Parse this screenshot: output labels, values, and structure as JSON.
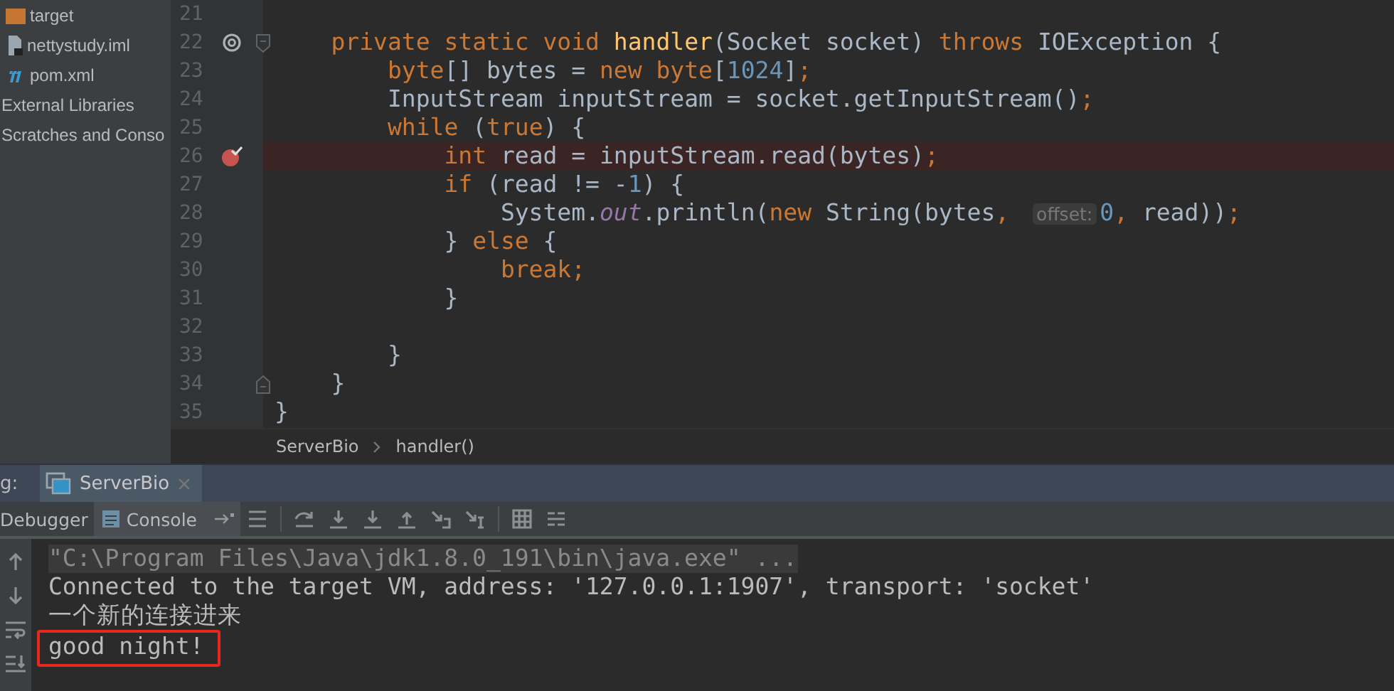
{
  "project_tree": {
    "items": [
      {
        "label": "target",
        "kind": "folder"
      },
      {
        "label": "nettystudy.iml",
        "kind": "module"
      },
      {
        "label": "pom.xml",
        "kind": "maven"
      },
      {
        "label": "External Libraries",
        "kind": "plain"
      },
      {
        "label": "Scratches and Conso",
        "kind": "plain"
      }
    ]
  },
  "editor": {
    "lines": [
      {
        "number": "21",
        "highlighted": false
      },
      {
        "number": "22",
        "override_marker": true,
        "fold_start": true,
        "highlighted": false,
        "tokens": [
          {
            "kind": "keyword",
            "text": "    private static void "
          },
          {
            "kind": "function",
            "text": "handler"
          },
          {
            "kind": "plain",
            "text": "(Socket socket) "
          },
          {
            "kind": "keyword",
            "text": "throws "
          },
          {
            "kind": "plain",
            "text": "IOException {"
          }
        ]
      },
      {
        "number": "23",
        "highlighted": false,
        "tokens": [
          {
            "kind": "keyword",
            "text": "        byte"
          },
          {
            "kind": "plain",
            "text": "[] bytes = "
          },
          {
            "kind": "keyword",
            "text": "new byte"
          },
          {
            "kind": "plain",
            "text": "["
          },
          {
            "kind": "number",
            "text": "1024"
          },
          {
            "kind": "plain",
            "text": "]"
          },
          {
            "kind": "keyword",
            "text": ";"
          }
        ]
      },
      {
        "number": "24",
        "highlighted": false,
        "tokens": [
          {
            "kind": "plain",
            "text": "        InputStream inputStream = socket.getInputStream()"
          },
          {
            "kind": "keyword",
            "text": ";"
          }
        ]
      },
      {
        "number": "25",
        "highlighted": false,
        "tokens": [
          {
            "kind": "keyword",
            "text": "        while "
          },
          {
            "kind": "plain",
            "text": "("
          },
          {
            "kind": "keyword",
            "text": "true"
          },
          {
            "kind": "plain",
            "text": ") {"
          }
        ]
      },
      {
        "number": "26",
        "breakpoint": true,
        "highlighted": true,
        "tokens": [
          {
            "kind": "keyword",
            "text": "            int "
          },
          {
            "kind": "plain",
            "text": "read = inputStream.read(bytes)"
          },
          {
            "kind": "keyword",
            "text": ";"
          }
        ]
      },
      {
        "number": "27",
        "highlighted": false,
        "tokens": [
          {
            "kind": "keyword",
            "text": "            if "
          },
          {
            "kind": "plain",
            "text": "(read != -"
          },
          {
            "kind": "number",
            "text": "1"
          },
          {
            "kind": "plain",
            "text": ") {"
          }
        ]
      },
      {
        "number": "28",
        "highlighted": false,
        "tokens": [
          {
            "kind": "plain",
            "text": "                System."
          },
          {
            "kind": "static",
            "text": "out"
          },
          {
            "kind": "plain",
            "text": ".println("
          },
          {
            "kind": "keyword",
            "text": "new "
          },
          {
            "kind": "plain",
            "text": "String(bytes"
          },
          {
            "kind": "keyword",
            "text": ", "
          },
          {
            "kind": "hint",
            "text": "offset:"
          },
          {
            "kind": "number",
            "text": "0"
          },
          {
            "kind": "keyword",
            "text": ", "
          },
          {
            "kind": "plain",
            "text": "read))"
          },
          {
            "kind": "keyword",
            "text": ";"
          }
        ]
      },
      {
        "number": "29",
        "highlighted": false,
        "tokens": [
          {
            "kind": "plain",
            "text": "            } "
          },
          {
            "kind": "keyword",
            "text": "else "
          },
          {
            "kind": "plain",
            "text": "{"
          }
        ]
      },
      {
        "number": "30",
        "highlighted": false,
        "tokens": [
          {
            "kind": "keyword",
            "text": "                break;"
          }
        ]
      },
      {
        "number": "31",
        "highlighted": false,
        "tokens": [
          {
            "kind": "plain",
            "text": "            }"
          }
        ]
      },
      {
        "number": "32",
        "highlighted": false
      },
      {
        "number": "33",
        "highlighted": false,
        "tokens": [
          {
            "kind": "plain",
            "text": "        }"
          }
        ]
      },
      {
        "number": "34",
        "fold_end": true,
        "highlighted": false,
        "tokens": [
          {
            "kind": "plain",
            "text": "    }"
          }
        ]
      },
      {
        "number": "35",
        "highlighted": false,
        "tokens": [
          {
            "kind": "plain",
            "text": "}"
          }
        ]
      }
    ],
    "breadcrumbs": [
      "ServerBio",
      "handler()"
    ]
  },
  "debug_panel": {
    "label": "g:",
    "tabs": [
      {
        "label": "ServerBio",
        "selected": true
      }
    ],
    "subtabs": [
      {
        "label": "Debugger",
        "selected": false
      },
      {
        "label": "Console",
        "selected": true
      }
    ],
    "console": [
      {
        "kind": "command",
        "text": "\"C:\\Program Files\\Java\\jdk1.8.0_191\\bin\\java.exe\" ...",
        "boxed": false
      },
      {
        "kind": "output",
        "text": "Connected to the target VM, address: '127.0.0.1:1907', transport: 'socket'",
        "boxed": false
      },
      {
        "kind": "output",
        "text": "一个新的连接进来",
        "boxed": false
      },
      {
        "kind": "output",
        "text": "good night!",
        "boxed": true
      }
    ]
  }
}
